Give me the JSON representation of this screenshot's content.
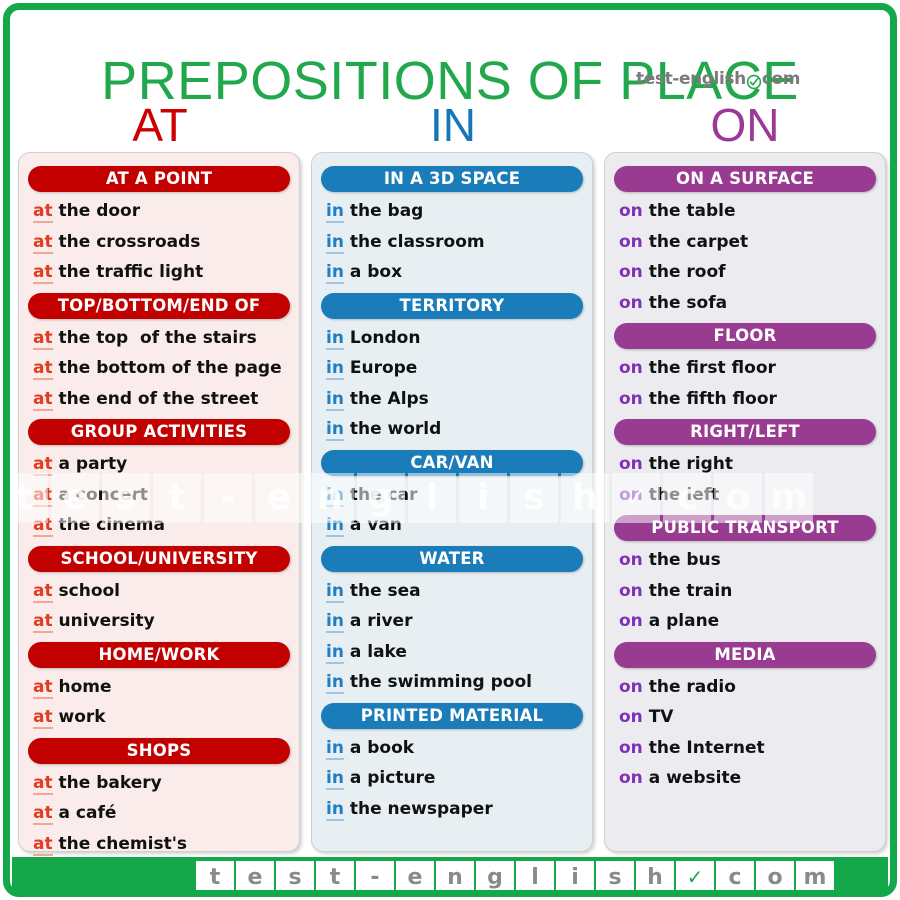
{
  "title": "PREPOSITIONS OF PLACE",
  "brand": {
    "header_left": "test-english",
    "header_right": "com",
    "check_icon": "✓",
    "accent_green": "#22a84c",
    "logo_gray": "#7b7b7b"
  },
  "columns": [
    {
      "letter": "AT",
      "color": "#cc0000",
      "bar_color": "#c20000",
      "panel_color": "#f9ecea",
      "preposition": "at",
      "groups": [
        {
          "heading": "AT A POINT",
          "items": [
            "the door",
            "the crossroads",
            "the traffic light"
          ]
        },
        {
          "heading": "TOP/BOTTOM/END OF",
          "items": [
            "the top  of the stairs",
            "the bottom of the page",
            "the end of the street"
          ]
        },
        {
          "heading": "GROUP ACTIVITIES",
          "items": [
            "a party",
            "a concert",
            "the cinema"
          ]
        },
        {
          "heading": "SCHOOL/UNIVERSITY",
          "items": [
            "school",
            "university"
          ]
        },
        {
          "heading": "HOME/WORK",
          "items": [
            "home",
            "work"
          ]
        },
        {
          "heading": "SHOPS",
          "items": [
            "the bakery",
            "a café",
            "the chemist's"
          ]
        }
      ]
    },
    {
      "letter": "IN",
      "color": "#1577b8",
      "bar_color": "#1b7cba",
      "panel_color": "#e8eff2",
      "preposition": "in",
      "groups": [
        {
          "heading": "IN A 3D SPACE",
          "items": [
            "the bag",
            "the classroom",
            "a box"
          ]
        },
        {
          "heading": "TERRITORY",
          "items": [
            "London",
            "Europe",
            "the Alps",
            "the world"
          ]
        },
        {
          "heading": "CAR/VAN",
          "items": [
            "the car",
            "a van"
          ]
        },
        {
          "heading": "WATER",
          "items": [
            "the sea",
            "a river",
            "a lake",
            "the swimming pool"
          ]
        },
        {
          "heading": "PRINTED MATERIAL",
          "items": [
            "a book",
            "a picture",
            "the newspaper"
          ]
        }
      ]
    },
    {
      "letter": "ON",
      "color": "#9b3a96",
      "bar_color": "#993b91",
      "panel_color": "#ececf0",
      "preposition": "on",
      "groups": [
        {
          "heading": "ON A SURFACE",
          "items": [
            "the table",
            "the carpet",
            "the roof",
            "the sofa"
          ]
        },
        {
          "heading": "FLOOR",
          "items": [
            "the first floor",
            "the fifth floor"
          ]
        },
        {
          "heading": "RIGHT/LEFT",
          "items": [
            "the right",
            "the left"
          ]
        },
        {
          "heading": "PUBLIC TRANSPORT",
          "items": [
            "the bus",
            "the train",
            "a plane"
          ]
        },
        {
          "heading": "MEDIA",
          "items": [
            "the radio",
            "TV",
            "the Internet",
            "a website"
          ]
        }
      ]
    }
  ],
  "watermark": {
    "letters": [
      "t",
      "e",
      "s",
      "t",
      "-",
      "e",
      "n",
      "g",
      "l",
      "i",
      "s",
      "h",
      "✓",
      "c",
      "o",
      "m"
    ],
    "check_index": 12
  },
  "footer": {
    "letters": [
      "t",
      "e",
      "s",
      "t",
      "-",
      "e",
      "n",
      "g",
      "l",
      "i",
      "s",
      "h",
      "✓",
      "c",
      "o",
      "m"
    ],
    "check_index": 12,
    "background": "#14a84b"
  }
}
